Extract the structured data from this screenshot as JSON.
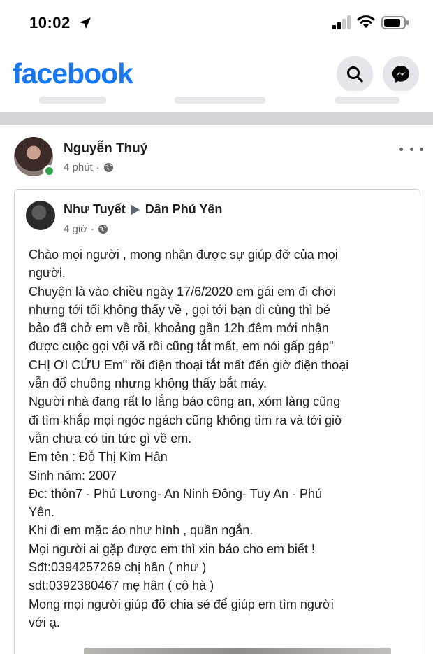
{
  "status_bar": {
    "time": "10:02",
    "icons": [
      "location-arrow-icon",
      "signal-bars-icon",
      "wifi-icon",
      "battery-icon"
    ]
  },
  "header": {
    "logo": "facebook",
    "brand_color": "#1877f2",
    "buttons": [
      "search-icon",
      "messenger-icon"
    ]
  },
  "post": {
    "author": "Nguyễn Thuý",
    "time": "4 phút",
    "privacy_icon": "globe-icon",
    "online_color": "#31a24c",
    "shared_post": {
      "author": "Như Tuyết",
      "group": "Dân Phú Yên",
      "time": "4 giờ",
      "privacy_icon": "globe-icon",
      "lines": [
        "Chào mọi người , mong nhận được sự giúp đỡ của mọi",
        "người.",
        "Chuyện là vào chiều ngày 17/6/2020 em gái em đi chơi",
        "nhưng tới tối không thấy về , gọi tới bạn đi cùng  thì bé",
        "bảo đã chở em về rồi, khoảng gần 12h đêm mới nhận",
        "được cuộc gọi vội vã rồi cũng tắt mất, em nói gấp gáp\"",
        "CHỊ ƠI CỨU Em\" rồi điện thoại tắt mất đến giờ điện thoại",
        "vẫn đổ chuông nhưng không thấy bắt máy.",
        "Người nhà đang rất lo lắng báo công an, xóm làng cũng",
        "đi tìm khắp mọi ngóc ngách cũng không tìm ra và tới giờ",
        "vẫn chưa có tin tức gì về em.",
        "Em tên : Đỗ Thị Kim Hân",
        "Sinh năm: 2007",
        "Đc: thôn7 -  Phú Lương- An Ninh Đông- Tuy An -  Phú",
        "Yên.",
        "Khi đi em mặc áo như hình , quần ngắn.",
        "Mọi người ai gặp được em thì xin báo cho em biết !",
        "Sđt:0394257269 chị hân ( như )",
        "sdt:0392380467 mẹ hân ( cô hà )",
        "Mong mọi người giúp đỡ chia sẻ để giúp em tìm người",
        "với ạ."
      ]
    }
  }
}
